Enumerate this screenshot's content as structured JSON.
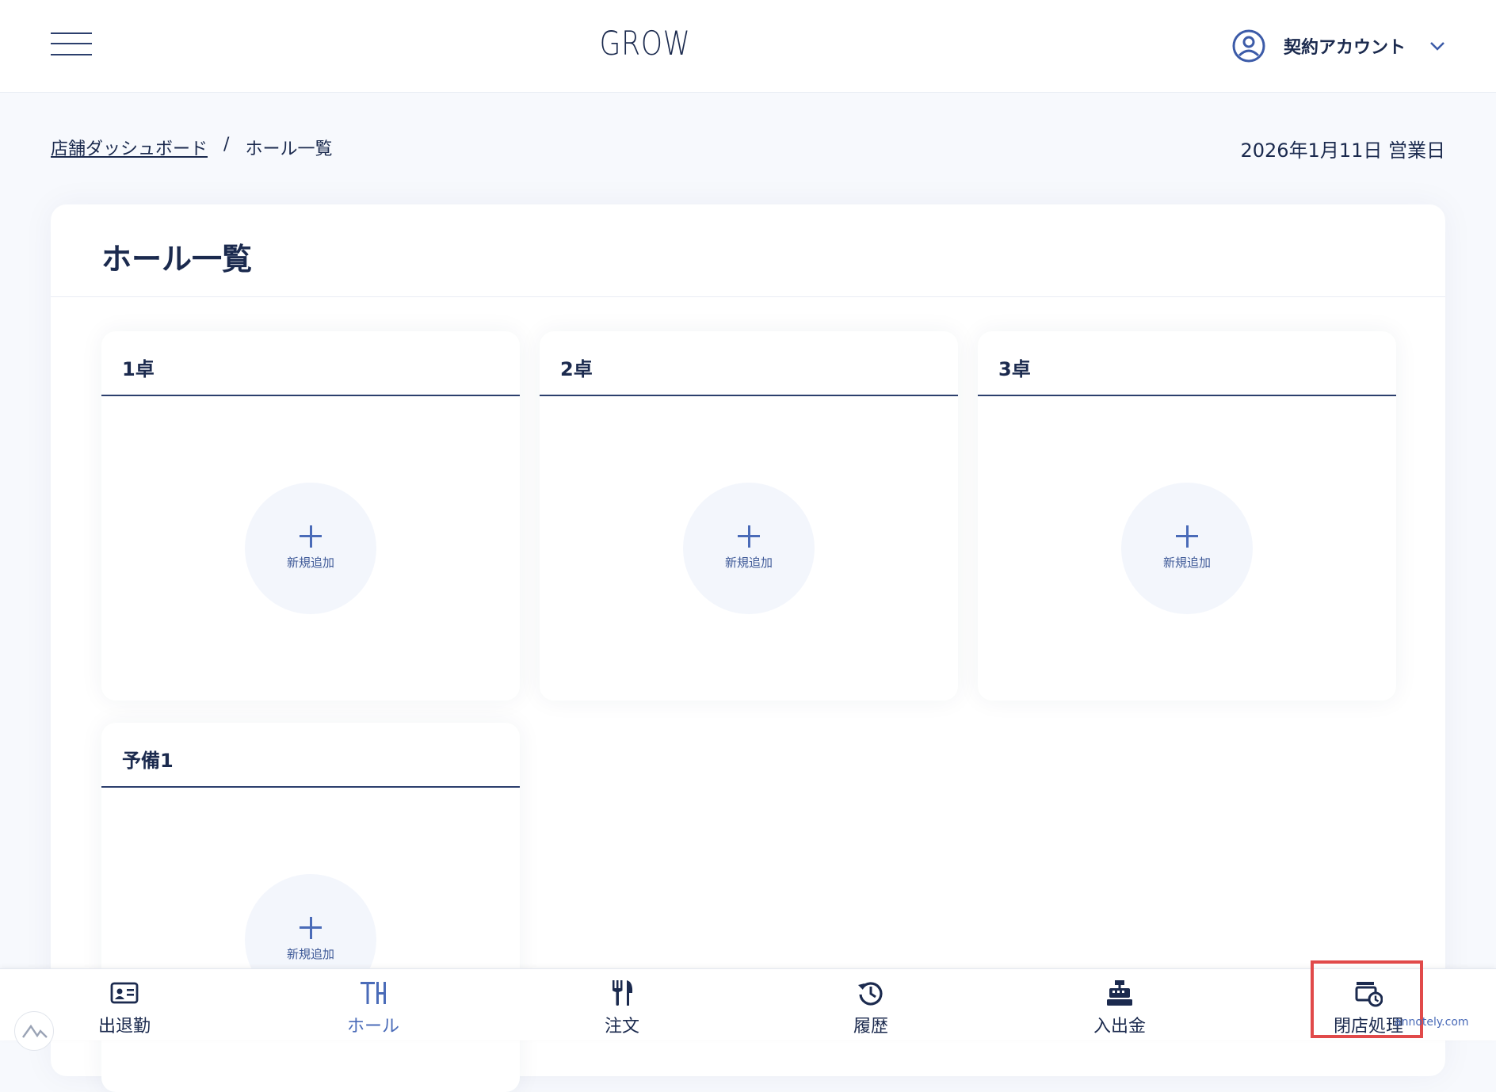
{
  "header": {
    "brand": "GROW",
    "account_label": "契約アカウント"
  },
  "breadcrumb": {
    "home": "店舗ダッシュボード",
    "separator": "/",
    "current": "ホール一覧"
  },
  "business_date": "2026年1月11日 営業日",
  "panel": {
    "title": "ホール一覧"
  },
  "tables": [
    {
      "name": "1卓",
      "add_label": "新規追加"
    },
    {
      "name": "2卓",
      "add_label": "新規追加"
    },
    {
      "name": "3卓",
      "add_label": "新規追加"
    },
    {
      "name": "予備1",
      "add_label": "新規追加"
    }
  ],
  "nav": [
    {
      "label": "出退勤",
      "icon": "id-card-icon"
    },
    {
      "label": "ホール",
      "icon": "table-hall-icon",
      "active": true
    },
    {
      "label": "注文",
      "icon": "fork-knife-icon"
    },
    {
      "label": "履歴",
      "icon": "history-icon"
    },
    {
      "label": "入出金",
      "icon": "cash-register-icon"
    },
    {
      "label": "閉店処理",
      "icon": "register-clock-icon"
    }
  ],
  "watermark": "annotely.com",
  "colors": {
    "primary": "#1b2a4e",
    "accent": "#4a6bb8",
    "background": "#f7f9fd",
    "highlight": "#e14a4a"
  }
}
